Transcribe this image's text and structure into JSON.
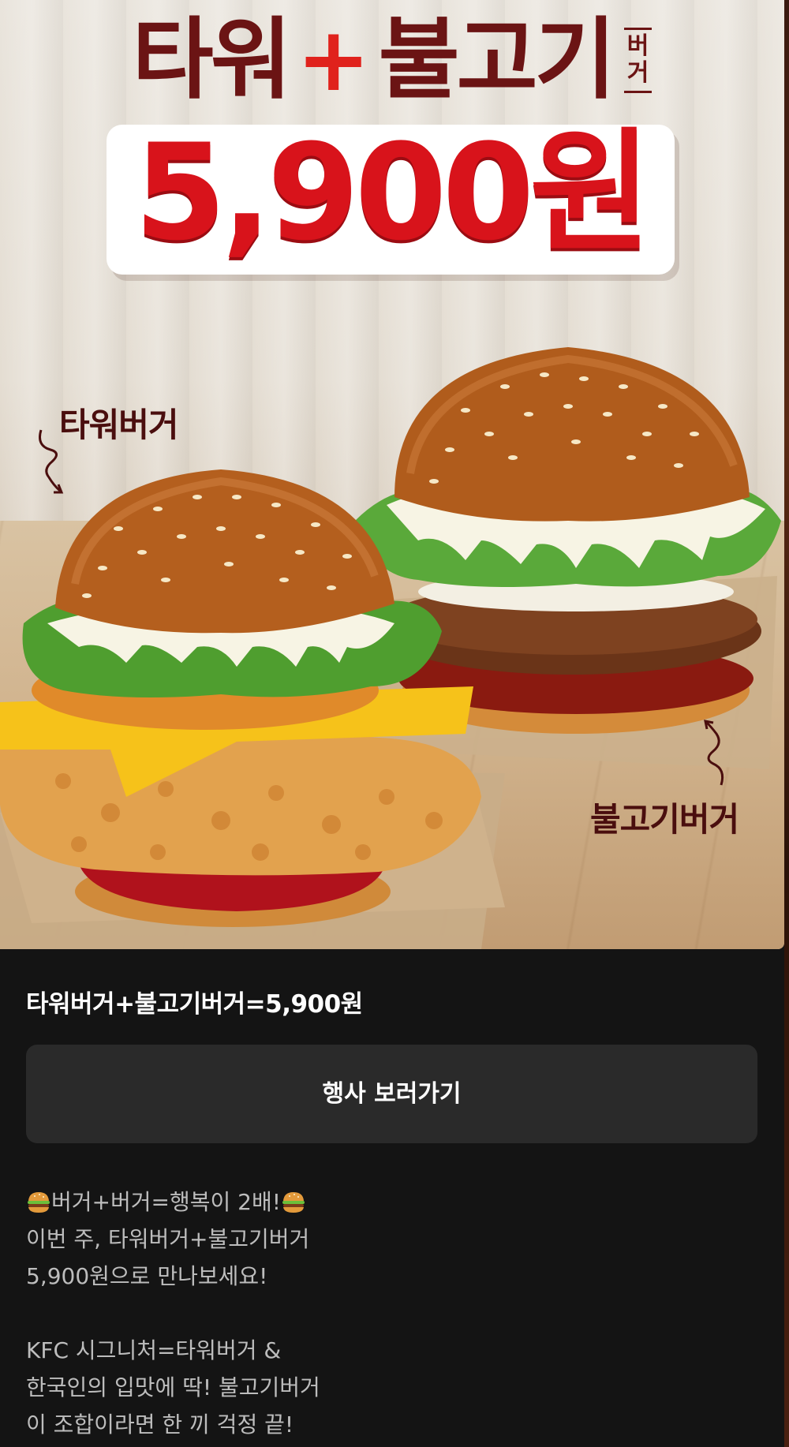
{
  "banner": {
    "headline_left": "타워",
    "headline_plus": "+",
    "headline_right": "불고기",
    "burger_tag_top": "버",
    "burger_tag_bottom": "거",
    "price": "5,900원",
    "label_tower": "타워버거",
    "label_bulgogi": "불고기버거"
  },
  "event": {
    "title": "타워버거+불고기버거=5,900원",
    "cta_label": "행사 보러가기"
  },
  "description": {
    "line1": "버거+버거=행복이 2배!",
    "line2": "이번 주, 타워버거+불고기버거",
    "line3": "5,900원으로 만나보세요!",
    "line4": "KFC 시그니처=타워버거 &",
    "line5": "한국인의 입맛에 딱! 불고기버거",
    "line6": "이 조합이라면 한 끼 걱정 끝!"
  },
  "icons": {
    "emoji": "hamburger-icon",
    "arrows": "curly-arrow-icon"
  },
  "colors": {
    "background": "#141414",
    "headline": "#6b1414",
    "accent_red": "#d8131b",
    "button": "#2a2a2a",
    "text_primary": "#ffffff",
    "text_secondary": "#bdbdbd"
  }
}
